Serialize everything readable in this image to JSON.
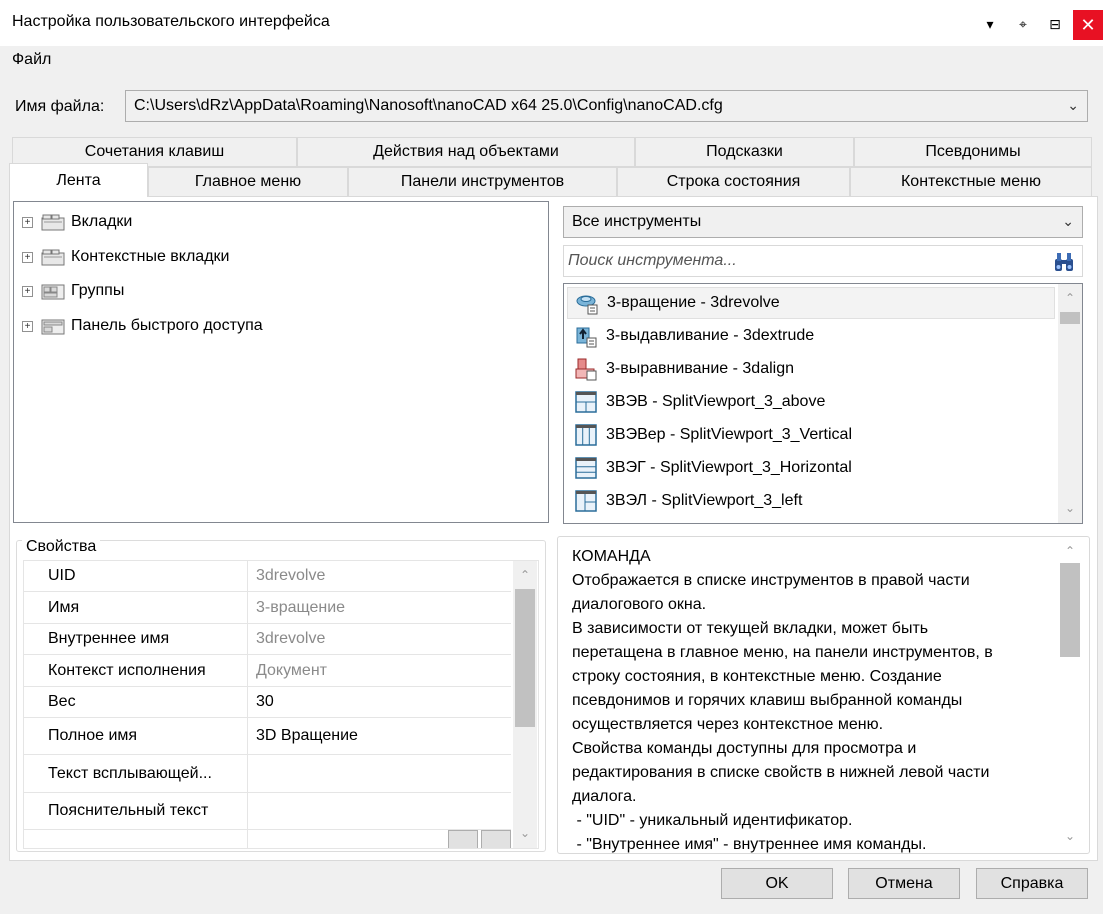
{
  "window": {
    "title": "Настройка пользовательского интерфейса",
    "buttons": [
      "▾",
      "⌖",
      "⊟",
      "✕"
    ]
  },
  "menu": {
    "file": "Файл"
  },
  "file": {
    "label": "Имя файла:",
    "path": "C:\\Users\\dRz\\AppData\\Roaming\\Nanosoft\\nanoCAD x64 25.0\\Config\\nanoCAD.cfg"
  },
  "tabs": {
    "row1": [
      "Сочетания клавиш",
      "Действия над объектами",
      "Подсказки",
      "Псевдонимы"
    ],
    "row2": [
      "Лента",
      "Главное меню",
      "Панели инструментов",
      "Строка состояния",
      "Контекстные меню"
    ],
    "active": "Лента"
  },
  "tree": {
    "items": [
      "Вкладки",
      "Контекстные вкладки",
      "Группы",
      "Панель быстрого доступа"
    ]
  },
  "tools": {
    "filter": "Все инструменты",
    "search_placeholder": "Поиск инструмента...",
    "items": [
      {
        "label": "3-вращение - 3drevolve",
        "icon": "revolve-icon"
      },
      {
        "label": "3-выдавливание - 3dextrude",
        "icon": "extrude-icon"
      },
      {
        "label": "3-выравнивание - 3dalign",
        "icon": "align-icon"
      },
      {
        "label": "3ВЭВ - SplitViewport_3_above",
        "icon": "viewport-above-icon"
      },
      {
        "label": "3ВЭВер - SplitViewport_3_Vertical",
        "icon": "viewport-vertical-icon"
      },
      {
        "label": "3ВЭГ - SplitViewport_3_Horizontal",
        "icon": "viewport-horizontal-icon"
      },
      {
        "label": "3ВЭЛ - SplitViewport_3_left",
        "icon": "viewport-left-icon"
      }
    ],
    "selected_index": 0
  },
  "properties": {
    "title": "Свойства",
    "rows": [
      {
        "name": "UID",
        "value": "3drevolve",
        "readonly": true
      },
      {
        "name": "Имя",
        "value": "3-вращение",
        "readonly": true
      },
      {
        "name": "Внутреннее имя",
        "value": "3drevolve",
        "readonly": true
      },
      {
        "name": "Контекст исполнения",
        "value": "Документ",
        "readonly": true
      },
      {
        "name": "Вес",
        "value": "30",
        "readonly": false
      },
      {
        "name": "Полное имя",
        "value": "3D Вращение",
        "readonly": false
      },
      {
        "name": "Текст всплывающей...",
        "value": "",
        "readonly": false
      },
      {
        "name": "Пояснительный текст",
        "value": "",
        "readonly": false
      }
    ]
  },
  "description": {
    "lines": [
      "КОМАНДА",
      "Отображается в списке инструментов в правой части",
      "диалогового окна.",
      "В зависимости от текущей вкладки, может быть",
      "перетащена в главное меню, на панели инструментов, в",
      "строку состояния, в контекстные меню. Создание",
      "псевдонимов и горячих клавиш выбранной команды",
      "осуществляется через контекстное меню.",
      "Свойства команды доступны для просмотра и",
      "редактирования в списке свойств в нижней левой части",
      "диалога.",
      " - \"UID\" - уникальный идентификатор.",
      " - \"Внутреннее имя\" - внутреннее имя команды."
    ]
  },
  "footer": {
    "ok": "OK",
    "cancel": "Отмена",
    "help": "Справка"
  },
  "colors": {
    "close": "#e81123",
    "selection": "#f3f3f3",
    "accent": "#2a7ab0"
  }
}
